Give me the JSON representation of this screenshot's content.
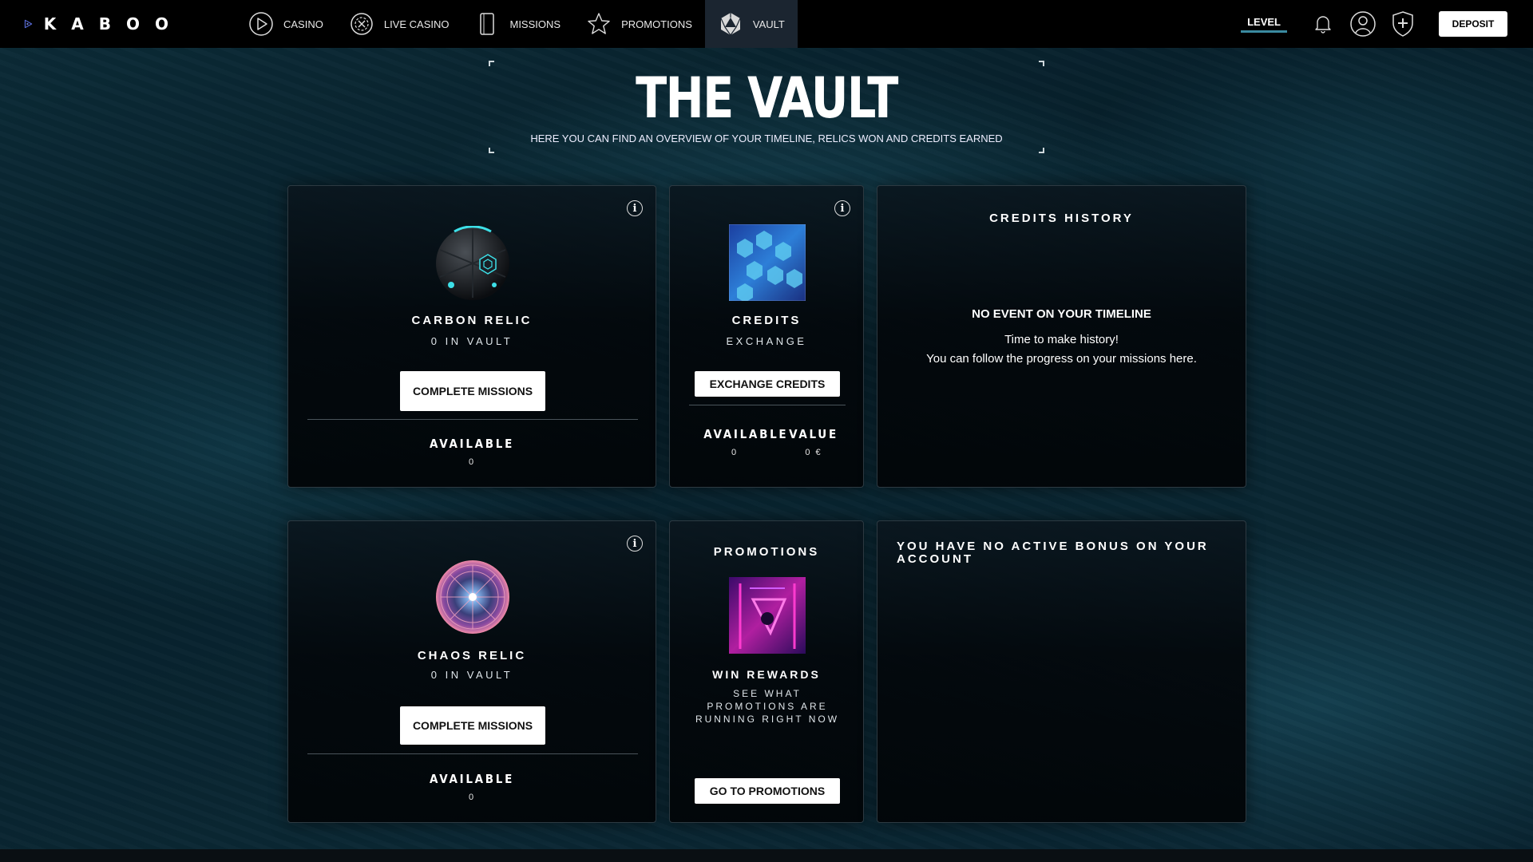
{
  "brand": {
    "name": "KABOO",
    "accent": "#5b6fe0"
  },
  "nav": {
    "items": [
      {
        "label": "CASINO",
        "icon": "play-circle-icon"
      },
      {
        "label": "LIVE CASINO",
        "icon": "roulette-icon"
      },
      {
        "label": "MISSIONS",
        "icon": "missions-card-icon"
      },
      {
        "label": "PROMOTIONS",
        "icon": "star-icon"
      },
      {
        "label": "VAULT",
        "icon": "vault-dice-icon",
        "active": true
      }
    ],
    "level_label": "LEVEL",
    "deposit_label": "DEPOSIT"
  },
  "hero": {
    "title": "THE VAULT",
    "subtitle": "HERE YOU CAN FIND AN OVERVIEW OF YOUR TIMELINE, RELICS WON AND CREDITS EARNED"
  },
  "carbon_relic": {
    "title": "CARBON RELIC",
    "sub": "0 IN VAULT",
    "button": "COMPLETE MISSIONS",
    "available_label": "AVAILABLE",
    "available_value": "0"
  },
  "credits": {
    "title": "CREDITS",
    "sub": "EXCHANGE",
    "button": "EXCHANGE CREDITS",
    "available_label": "AVAILABLE",
    "available_value": "0",
    "value_label": "VALUE",
    "value_value": "0 €"
  },
  "credits_history": {
    "title": "CREDITS HISTORY",
    "empty_title": "NO EVENT ON YOUR TIMELINE",
    "empty_line1": "Time to make history!",
    "empty_line2": "You can follow the progress on your missions here."
  },
  "chaos_relic": {
    "title": "CHAOS RELIC",
    "sub": "0 IN VAULT",
    "button": "COMPLETE MISSIONS",
    "available_label": "AVAILABLE",
    "available_value": "0"
  },
  "promotions": {
    "title": "PROMOTIONS",
    "win_title": "WIN REWARDS",
    "win_sub": "SEE WHAT PROMOTIONS ARE RUNNING RIGHT NOW",
    "button": "GO TO PROMOTIONS"
  },
  "bonus": {
    "title": "YOU HAVE NO ACTIVE BONUS ON YOUR ACCOUNT"
  },
  "info_glyph": "i"
}
